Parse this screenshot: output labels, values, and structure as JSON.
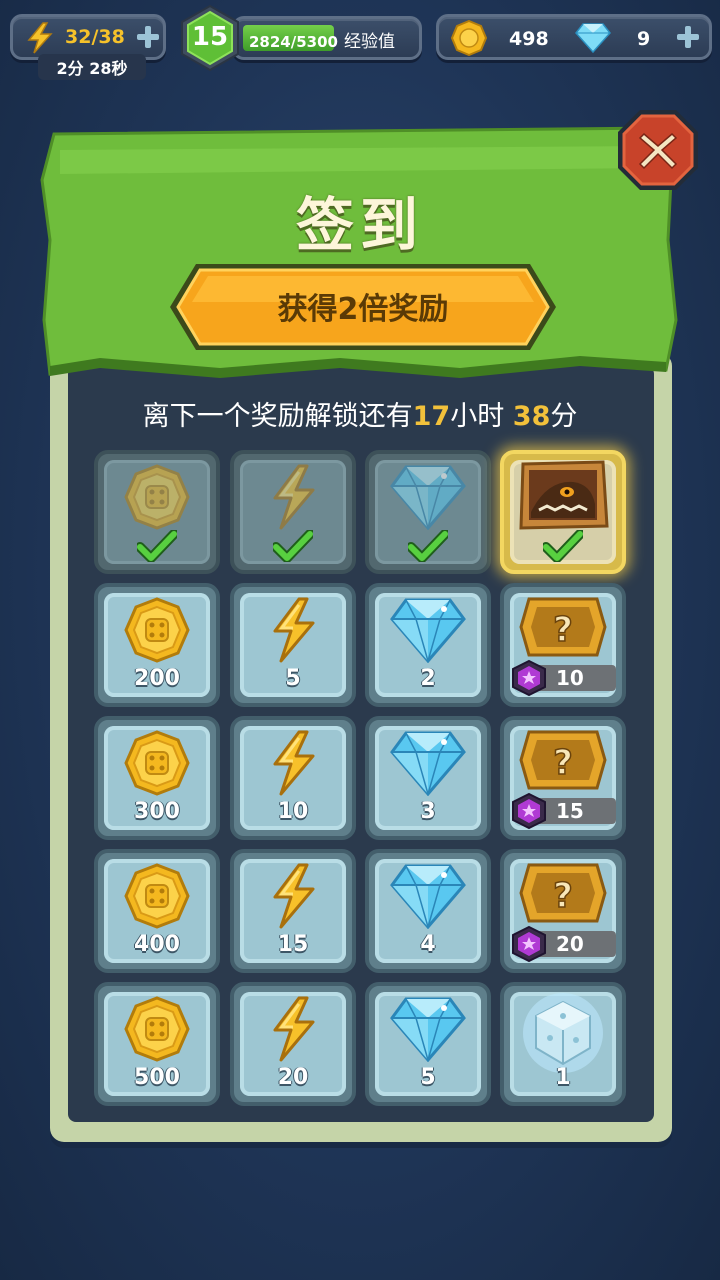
{
  "hud": {
    "energy": "32/38",
    "energy_timer": "2分 28秒",
    "level": "15",
    "exp_text": "2824/5300",
    "exp_label": "经验值",
    "exp_progress": 0.53,
    "coins": "498",
    "gems": "9"
  },
  "panel": {
    "title": "签到",
    "double_reward_button": "获得2倍奖励",
    "countdown": {
      "prefix": "离下一个奖励解锁还有",
      "hours": "17",
      "hours_unit": "小时",
      "minutes": "38",
      "minutes_unit": "分"
    }
  },
  "rewards": [
    {
      "type": "coin",
      "qty": "",
      "state": "claimed"
    },
    {
      "type": "energy",
      "qty": "",
      "state": "claimed"
    },
    {
      "type": "gem",
      "qty": "",
      "state": "claimed"
    },
    {
      "type": "monster-card",
      "qty": "",
      "state": "today-claimed"
    },
    {
      "type": "coin",
      "qty": "200",
      "state": "locked"
    },
    {
      "type": "energy",
      "qty": "5",
      "state": "locked"
    },
    {
      "type": "gem",
      "qty": "2",
      "state": "locked"
    },
    {
      "type": "mystery-box",
      "qty": "10",
      "state": "locked"
    },
    {
      "type": "coin",
      "qty": "300",
      "state": "locked"
    },
    {
      "type": "energy",
      "qty": "10",
      "state": "locked"
    },
    {
      "type": "gem",
      "qty": "3",
      "state": "locked"
    },
    {
      "type": "mystery-box",
      "qty": "15",
      "state": "locked"
    },
    {
      "type": "coin",
      "qty": "400",
      "state": "locked"
    },
    {
      "type": "energy",
      "qty": "15",
      "state": "locked"
    },
    {
      "type": "gem",
      "qty": "4",
      "state": "locked"
    },
    {
      "type": "mystery-box",
      "qty": "20",
      "state": "locked"
    },
    {
      "type": "coin",
      "qty": "500",
      "state": "locked"
    },
    {
      "type": "energy",
      "qty": "20",
      "state": "locked"
    },
    {
      "type": "gem",
      "qty": "5",
      "state": "locked"
    },
    {
      "type": "ice-dice",
      "qty": "1",
      "state": "locked"
    }
  ],
  "colors": {
    "background": "#1f3557",
    "banner_green": "#6fbd3c",
    "button_orange": "#f7a51c",
    "highlight_yellow": "#f2c13b",
    "close_red": "#c8432a"
  },
  "icons": [
    "lightning-icon",
    "plus-icon",
    "level-badge-icon",
    "coin-icon",
    "diamond-icon",
    "close-icon",
    "check-icon",
    "mystery-box-icon",
    "purple-gem-icon",
    "ice-dice-icon",
    "monster-card-icon"
  ]
}
